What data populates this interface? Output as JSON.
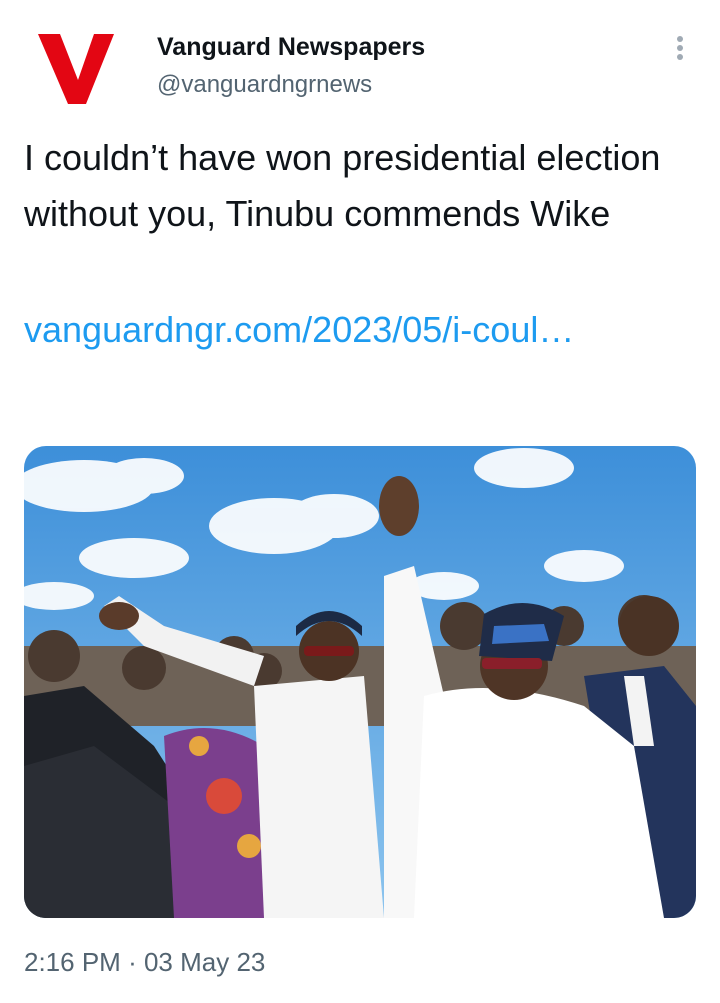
{
  "account": {
    "display_name": "Vanguard Newspapers",
    "handle": "@vanguardngrnews",
    "avatar_icon": "vanguard-v-logo",
    "avatar_color": "#e30613"
  },
  "more_icon": "more-vertical-icon",
  "tweet": {
    "text": "I couldn’t have won presidential election without you, Tinubu commends Wike",
    "link_text": "vanguardngr.com/2023/05/i-coul…",
    "link_color": "#1d9bf0"
  },
  "media": {
    "type": "photo"
  },
  "meta": {
    "time": "2:16 PM",
    "separator": "·",
    "date": "03 May 23"
  }
}
